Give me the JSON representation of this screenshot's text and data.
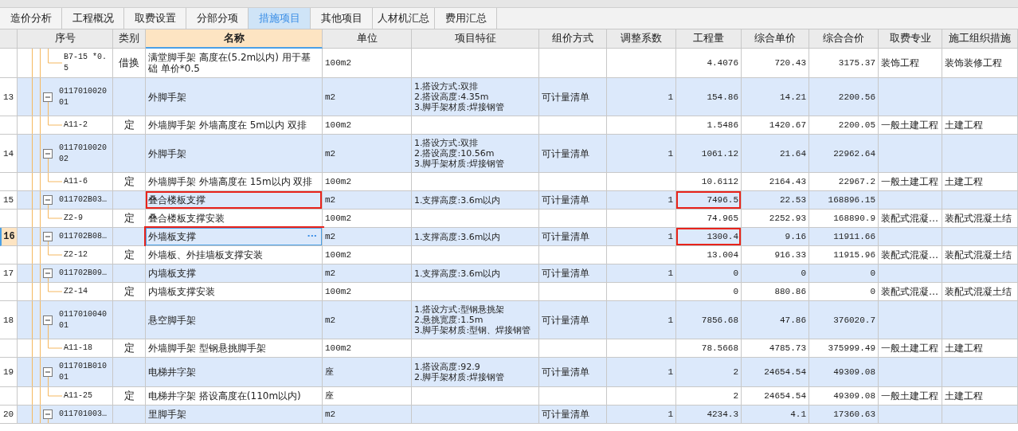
{
  "tabs": [
    {
      "label": "造价分析",
      "selected": false
    },
    {
      "label": "工程概况",
      "selected": false
    },
    {
      "label": "取费设置",
      "selected": false
    },
    {
      "label": "分部分项",
      "selected": false
    },
    {
      "label": "措施项目",
      "selected": true
    },
    {
      "label": "其他项目",
      "selected": false
    },
    {
      "label": "人材机汇总",
      "selected": false
    },
    {
      "label": "费用汇总",
      "selected": false
    }
  ],
  "table": {
    "columns": [
      {
        "selected": false
      },
      {
        "label": "序号",
        "selected": false
      },
      {
        "label": "类别",
        "selected": false
      },
      {
        "label": "名称",
        "selected": true
      },
      {
        "label": "单位",
        "selected": false
      },
      {
        "label": "项目特征",
        "selected": false
      },
      {
        "label": "组价方式",
        "selected": false
      },
      {
        "label": "调整系数",
        "selected": false
      },
      {
        "label": "工程量",
        "selected": false
      },
      {
        "label": "综合单价",
        "selected": false
      },
      {
        "label": "综合合价",
        "selected": false
      },
      {
        "label": "取费专业",
        "selected": false
      },
      {
        "label": "施工组织措施",
        "selected": false
      }
    ],
    "rows": [
      {
        "kind": "quota",
        "code": "B7-15 *0.5",
        "type": "借换",
        "name": "满堂脚手架 高度在(5.2m以内) 用于基础 单价*0.5",
        "unit": "100m2",
        "qty": "4.4076",
        "unit_price": "720.43",
        "total": "3175.37",
        "fee_major": "装饰工程",
        "org_type": "装饰装修工程",
        "selected": false,
        "marked": false
      },
      {
        "kind": "list",
        "number": "13",
        "code": "011701002001",
        "name": "外脚手架",
        "unit": "m2",
        "features": [
          "1.搭设方式:双排",
          "2.搭设高度:4.35m",
          "3.脚手架材质:焊接钢管"
        ],
        "method": "可计量清单",
        "factor": "1",
        "qty": "154.86",
        "unit_price": "14.21",
        "total": "2200.56",
        "selected": false,
        "marked": false
      },
      {
        "kind": "quota",
        "code": "A11-2",
        "type": "定",
        "name": "外墙脚手架 外墙高度在 5m以内 双排",
        "unit": "100m2",
        "qty": "1.5486",
        "unit_price": "1420.67",
        "total": "2200.05",
        "fee_major": "一般土建工程",
        "org_type": "土建工程",
        "selected": false,
        "marked": false
      },
      {
        "kind": "list",
        "number": "14",
        "code": "011701002002",
        "name": "外脚手架",
        "unit": "m2",
        "features": [
          "1.搭设方式:双排",
          "2.搭设高度:10.56m",
          "3.脚手架材质:焊接钢管"
        ],
        "method": "可计量清单",
        "factor": "1",
        "qty": "1061.12",
        "unit_price": "21.64",
        "total": "22962.64",
        "selected": false,
        "marked": false
      },
      {
        "kind": "quota",
        "code": "A11-6",
        "type": "定",
        "name": "外墙脚手架 外墙高度在 15m以内 双排",
        "unit": "100m2",
        "qty": "10.6112",
        "unit_price": "2164.43",
        "total": "22967.2",
        "fee_major": "一般土建工程",
        "org_type": "土建工程",
        "selected": false,
        "marked": false
      },
      {
        "kind": "list",
        "number": "15",
        "code": "011702B03…",
        "name": "叠合楼板支撑",
        "unit": "m2",
        "features": [
          "1.支撑高度:3.6m以内"
        ],
        "method": "可计量清单",
        "factor": "1",
        "qty": "7496.5",
        "unit_price": "22.53",
        "total": "168896.15",
        "selected": false,
        "marked": true
      },
      {
        "kind": "quota",
        "code": "Z2-9",
        "type": "定",
        "name": "叠合楼板支撑安装",
        "unit": "100m2",
        "qty": "74.965",
        "unit_price": "2252.93",
        "total": "168890.9",
        "fee_major": "装配式混凝…",
        "org_type": "装配式混凝土结",
        "selected": false,
        "marked": false
      },
      {
        "kind": "list",
        "number": "16",
        "code": "011702B08…",
        "name": "外墙板支撑",
        "editor_button": "···",
        "unit": "m2",
        "features": [
          "1.支撑高度:3.6m以内"
        ],
        "method": "可计量清单",
        "factor": "1",
        "qty": "1300.4",
        "unit_price": "9.16",
        "total": "11911.66",
        "selected": true,
        "marked": true
      },
      {
        "kind": "quota",
        "code": "Z2-12",
        "type": "定",
        "name": "外墙板、外挂墙板支撑安装",
        "unit": "100m2",
        "qty": "13.004",
        "unit_price": "916.33",
        "total": "11915.96",
        "fee_major": "装配式混凝…",
        "org_type": "装配式混凝土结",
        "selected": false,
        "marked": false
      },
      {
        "kind": "list",
        "number": "17",
        "code": "011702B09…",
        "name": "内墙板支撑",
        "unit": "m2",
        "features": [
          "1.支撑高度:3.6m以内"
        ],
        "method": "可计量清单",
        "factor": "1",
        "qty": "0",
        "unit_price": "0",
        "total": "0",
        "selected": false,
        "marked": false
      },
      {
        "kind": "quota",
        "code": "Z2-14",
        "type": "定",
        "name": "内墙板支撑安装",
        "unit": "100m2",
        "qty": "0",
        "unit_price": "880.86",
        "total": "0",
        "fee_major": "装配式混凝…",
        "org_type": "装配式混凝土结",
        "selected": false,
        "marked": false
      },
      {
        "kind": "list",
        "number": "18",
        "code": "011701004001",
        "name": "悬空脚手架",
        "unit": "m2",
        "features": [
          "1.搭设方式:型钢悬挑架",
          "2.悬挑宽度:1.5m",
          "3.脚手架材质:型钢、焊接钢管"
        ],
        "method": "可计量清单",
        "factor": "1",
        "qty": "7856.68",
        "unit_price": "47.86",
        "total": "376020.7",
        "selected": false,
        "marked": false
      },
      {
        "kind": "quota",
        "code": "A11-18",
        "type": "定",
        "name": "外墙脚手架 型钢悬挑脚手架",
        "unit": "100m2",
        "qty": "78.5668",
        "unit_price": "4785.73",
        "total": "375999.49",
        "fee_major": "一般土建工程",
        "org_type": "土建工程",
        "selected": false,
        "marked": false
      },
      {
        "kind": "list",
        "number": "19",
        "code": "011701B01001",
        "name": "电梯井字架",
        "unit": "座",
        "features": [
          "1.搭设高度:92.9",
          "2.脚手架材质:焊接钢管"
        ],
        "method": "可计量清单",
        "factor": "1",
        "qty": "2",
        "unit_price": "24654.54",
        "total": "49309.08",
        "selected": false,
        "marked": false
      },
      {
        "kind": "quota",
        "code": "A11-25",
        "type": "定",
        "name": "电梯井字架 搭设高度在(110m以内)",
        "unit": "座",
        "qty": "2",
        "unit_price": "24654.54",
        "total": "49309.08",
        "fee_major": "一般土建工程",
        "org_type": "土建工程",
        "selected": false,
        "marked": false
      },
      {
        "kind": "list",
        "number": "20",
        "code": "011701003…",
        "name": "里脚手架",
        "unit": "m2",
        "method": "可计量清单",
        "factor": "1",
        "qty": "4234.3",
        "unit_price": "4.1",
        "total": "17360.63",
        "selected": false,
        "marked": false
      }
    ]
  }
}
